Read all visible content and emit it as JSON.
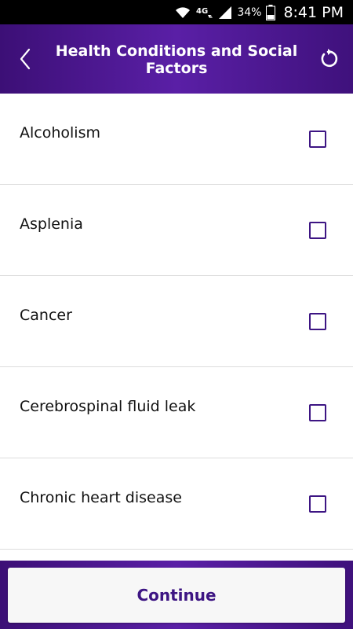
{
  "status_bar": {
    "network": "4G",
    "battery": "34%",
    "time": "8:41 PM",
    "icons": [
      "wifi-icon",
      "network-4g-icon",
      "signal-icon",
      "battery-icon"
    ]
  },
  "header": {
    "title": "Health Conditions and Social Factors",
    "back_icon": "chevron-left-icon",
    "refresh_icon": "refresh-icon"
  },
  "conditions": [
    {
      "label": "Alcoholism",
      "checked": false
    },
    {
      "label": "Asplenia",
      "checked": false
    },
    {
      "label": "Cancer",
      "checked": false
    },
    {
      "label": "Cerebrospinal fluid leak",
      "checked": false
    },
    {
      "label": "Chronic heart disease",
      "checked": false
    }
  ],
  "footer": {
    "continue_label": "Continue"
  },
  "colors": {
    "brand_purple": "#4a168f",
    "accent": "#3d1583",
    "divider": "#dcdcdc"
  }
}
